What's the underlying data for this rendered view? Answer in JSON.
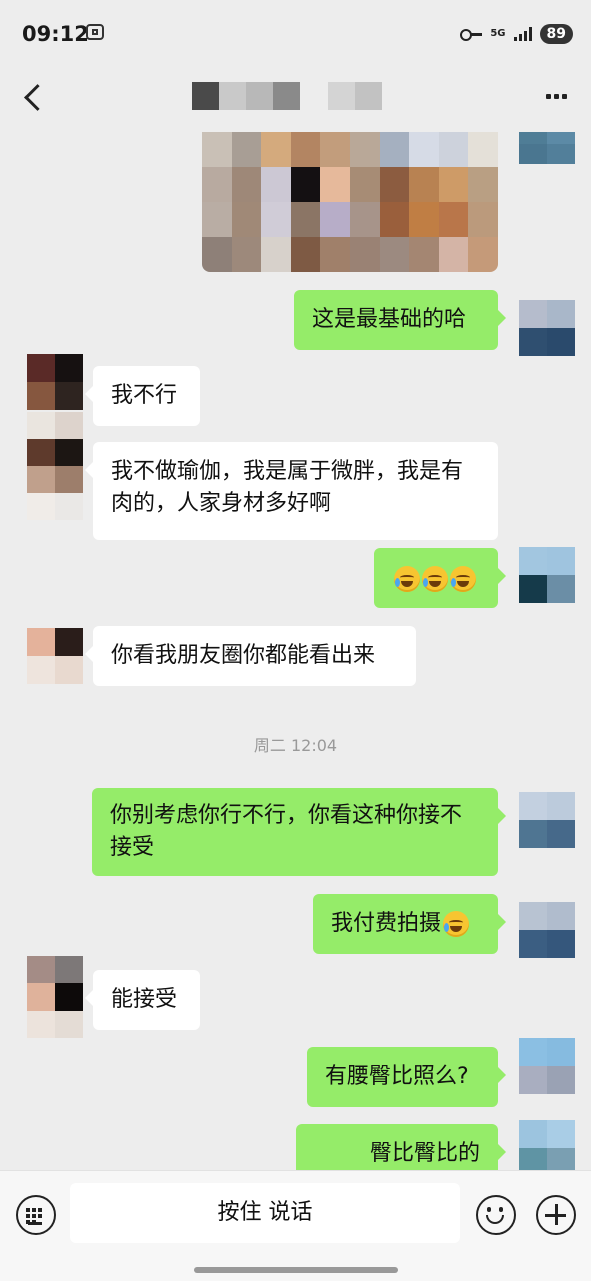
{
  "status": {
    "time": "09:12",
    "network": "5G",
    "battery": "89"
  },
  "header": {
    "title_blurred": true
  },
  "messages": [
    {
      "id": "m1",
      "side": "out",
      "type": "image"
    },
    {
      "id": "m2",
      "side": "out",
      "text": "这是最基础的哈"
    },
    {
      "id": "m3",
      "side": "in",
      "text": "我不行"
    },
    {
      "id": "m4",
      "side": "in",
      "text": "我不做瑜伽，我是属于微胖，我是有肉的，人家身材多好啊"
    },
    {
      "id": "m5",
      "side": "out",
      "emoji": [
        "laugh-cry-emoji",
        "laugh-cry-emoji",
        "laugh-cry-emoji"
      ]
    },
    {
      "id": "m6",
      "side": "in",
      "text": "你看我朋友圈你都能看出来"
    },
    {
      "id": "ts1",
      "type": "timestamp",
      "text": "周二 12:04"
    },
    {
      "id": "m7",
      "side": "out",
      "text": "你别考虑你行不行，你看这种你接不接受"
    },
    {
      "id": "m8",
      "side": "out",
      "text": "我付费拍摄",
      "emoji": [
        "laugh-cry-emoji"
      ]
    },
    {
      "id": "m9",
      "side": "in",
      "text": "能接受"
    },
    {
      "id": "m10",
      "side": "out",
      "text": "有腰臀比照么?"
    },
    {
      "id": "m11",
      "side": "out",
      "text": "臀比臀比的"
    }
  ],
  "input": {
    "hold_to_talk": "按住 说话"
  },
  "icons": [
    "keyboard-icon",
    "emoji-icon",
    "plus-icon",
    "back-icon",
    "more-icon"
  ]
}
